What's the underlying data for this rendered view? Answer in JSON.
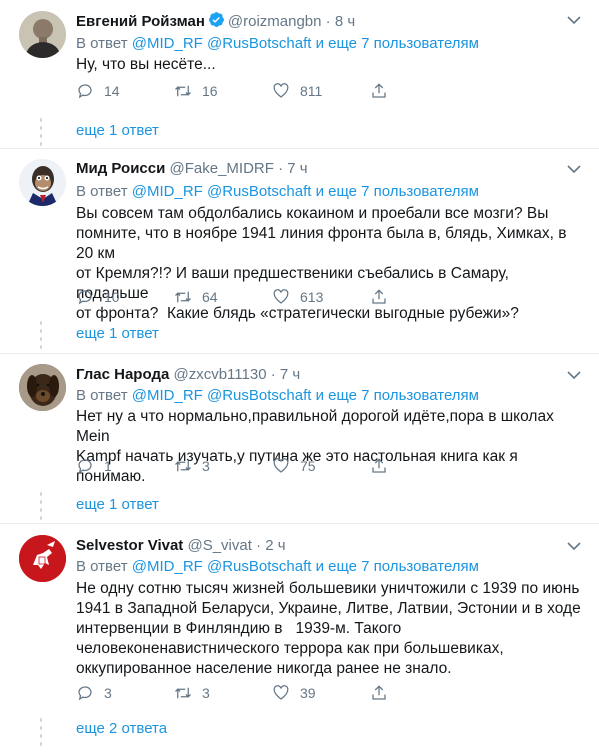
{
  "reply_prefix": "В ответ",
  "reply_and": "и еще 7 пользователям",
  "mention1": "@MID_RF",
  "mention2": "@RusBotschaft",
  "tweets": [
    {
      "name": "Евгений Ройзман",
      "handle": "@roizmangbn",
      "time": "· 8 ч",
      "text": "Ну, что вы несёте...",
      "replies": "14",
      "retweets": "16",
      "likes": "811",
      "more": "еще 1 ответ"
    },
    {
      "name": "Мид Роисси",
      "handle": "@Fake_MIDRF",
      "time": "· 7 ч",
      "text": "Вы совсем там обдолбались кокаином и проебали все мозги? Вы\nпомните, что в ноябре 1941 линия фронта была в, блядь, Химках, в 20 км\nот Кремля?!? И ваши предшественики съебались в Самару, подальше\nот фронта?  Какие блядь «стратегически выгодные рубежи»?",
      "replies": "10",
      "retweets": "64",
      "likes": "613",
      "more": "еще 1 ответ"
    },
    {
      "name": "Глас Народа",
      "handle": "@zxcvb11130",
      "time": "· 7 ч",
      "text": "Нет ну а что нормально,правильной дорогой идёте,пора в школах Mein\nKampf начать изучать,у путина же это настольная книга как я понимаю.",
      "replies": "1",
      "retweets": "3",
      "likes": "75",
      "more": "еще 1 ответ"
    },
    {
      "name": "Selvestor Vivat",
      "handle": "@S_vivat",
      "time": "· 2 ч",
      "text": "Не одну сотню тысяч жизней большевики уничтожили с 1939 по июнь\n1941 в Западной Беларуси, Украине, Литве, Латвии, Эстонии и в ходе\nинтервенции в Финляндию в   1939-м. Такого\nчеловеконенавистнического террора как при большевиках,\nоккупированное население никогда ранее не знало.",
      "replies": "3",
      "retweets": "3",
      "likes": "39",
      "more": "еще 2 ответа"
    }
  ],
  "colors": {
    "link": "#1b95e0",
    "muted": "#657786",
    "verified": "#1da1f2",
    "separator": "#e6ecf0"
  }
}
